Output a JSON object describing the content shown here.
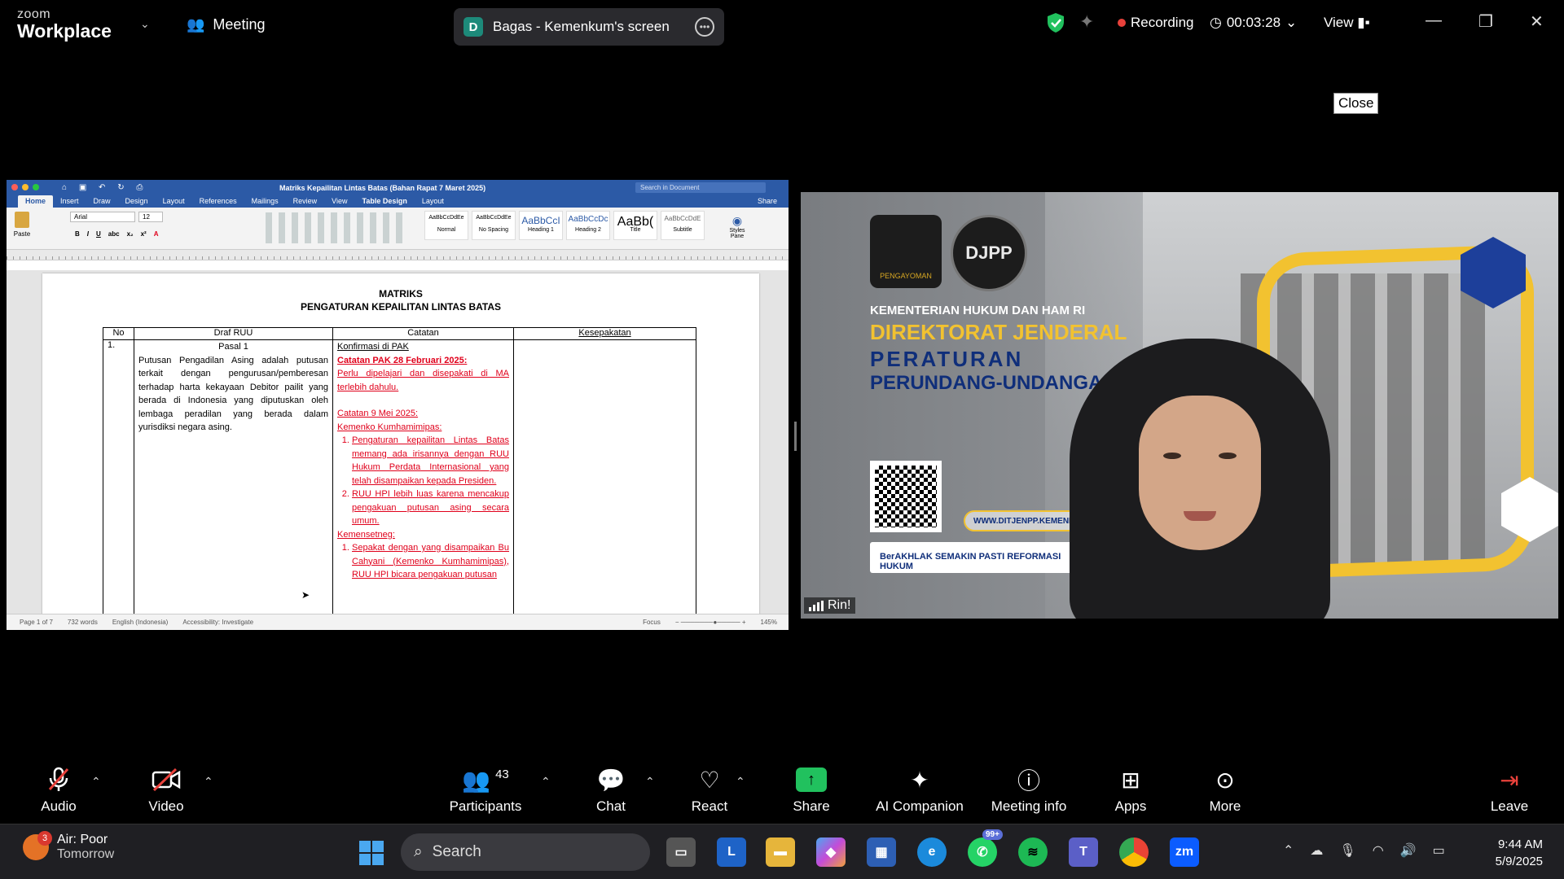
{
  "topbar": {
    "brand_top": "zoom",
    "brand_bottom": "Workplace",
    "meeting_label": "Meeting",
    "share_avatar": "D",
    "share_title": "Bagas - Kemenkum's screen",
    "recording_label": "Recording",
    "timer": "00:03:28",
    "view_label": "View",
    "close_tooltip": "Close"
  },
  "word": {
    "doc_title": "Matriks Kepailitan Lintas Batas (Bahan Rapat 7 Maret 2025)",
    "search_placeholder": "Search in Document",
    "tabs": [
      "Home",
      "Insert",
      "Draw",
      "Design",
      "Layout",
      "References",
      "Mailings",
      "Review",
      "View",
      "Table Design",
      "Layout"
    ],
    "share_label": "Share",
    "paste_label": "Paste",
    "font_name": "Arial",
    "font_size": "12",
    "styles": [
      {
        "preview": "AaBbCcDdEe",
        "name": "Normal"
      },
      {
        "preview": "AaBbCcDdEe",
        "name": "No Spacing"
      },
      {
        "preview": "AaBbCcI",
        "name": "Heading 1"
      },
      {
        "preview": "AaBbCcDc",
        "name": "Heading 2"
      },
      {
        "preview": "AaBb(",
        "name": "Title"
      },
      {
        "preview": "AaBbCcDdE",
        "name": "Subtitle"
      }
    ],
    "styles_pane": "Styles Pane",
    "heading1": "MATRIKS",
    "heading2": "PENGATURAN KEPAILITAN LINTAS BATAS",
    "table": {
      "headers": [
        "No",
        "Draf RUU",
        "Catatan",
        "Kesepakatan"
      ],
      "row_no": "1.",
      "pasal": "Pasal 1",
      "draft_text": "Putusan Pengadilan Asing adalah putusan terkait dengan pengurusan/pemberesan terhadap harta kekayaan Debitor pailit yang berada di Indonesia yang diputuskan oleh lembaga peradilan yang berada dalam yurisdiksi negara asing.",
      "notes": {
        "konfirmasi": "Konfirmasi di PAK",
        "catatan1": "Catatan PAK 28 Februari 2025:",
        "catatan1_text": "Perlu dipelajari dan disepakati di MA terlebih dahulu.",
        "catatan2": "Catatan 9 Mei 2025:",
        "kemenko": "Kemenko Kumhamimipas:",
        "list1": [
          "Pengaturan kepailitan Lintas Batas memang ada irisannya dengan RUU Hukum Perdata Internasional yang telah disampaikan kepada Presiden.",
          "RUU HPI lebih luas karena mencakup pengakuan putusan asing secara umum."
        ],
        "kemensetneg": "Kemensetneg:",
        "list2": [
          "Sepakat dengan yang disampaikan Bu Cahyani (Kemenko Kumhamimipas), RUU HPI bicara pengakuan putusan"
        ]
      }
    },
    "status": {
      "page": "Page 1 of 7",
      "words": "732 words",
      "language": "English (Indonesia)",
      "accessibility": "Accessibility: Investigate",
      "focus": "Focus",
      "zoom": "145%"
    }
  },
  "video": {
    "logo1_text": "PENGAYOMAN",
    "logo2_text": "DJPP",
    "org": "KEMENTERIAN HUKUM DAN HAM RI",
    "dir1": "DIREKTORAT JENDERAL",
    "dir2": "PERATURAN",
    "dir3": "PERUNDANG-UNDANGAN",
    "url": "WWW.DITJENPP.KEMENKUMHAM.GO.ID",
    "badges": "BerAKHLAK  SEMAKIN PASTI  REFORMASI HUKUM",
    "participant_name": "Rin!"
  },
  "toolbar": {
    "audio": "Audio",
    "video": "Video",
    "participants": "Participants",
    "participants_count": "43",
    "chat": "Chat",
    "react": "React",
    "share": "Share",
    "ai": "AI Companion",
    "info": "Meeting info",
    "apps": "Apps",
    "more": "More",
    "leave": "Leave"
  },
  "taskbar": {
    "weather_badge": "3",
    "weather_title": "Air: Poor",
    "weather_sub": "Tomorrow",
    "search_label": "Search",
    "whatsapp_badge": "99+",
    "time": "9:44 AM",
    "date": "5/9/2025"
  },
  "colors": {
    "word_blue": "#2c5aa6",
    "recording_red": "#e8413b",
    "share_green": "#21c15e",
    "note_red": "#e0001b",
    "banner_gold": "#f2c230"
  }
}
